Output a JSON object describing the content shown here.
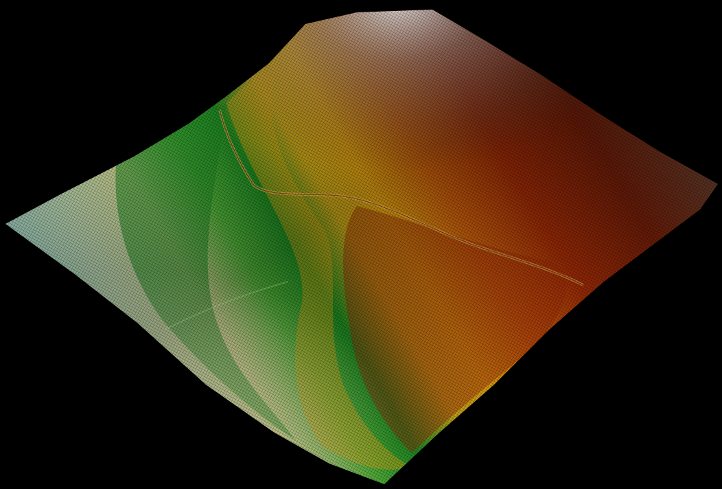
{
  "scene": {
    "background_color": "#000000",
    "subject": "terrain-mesh",
    "colormap": [
      {
        "stop": 0.0,
        "color": "#7fb0ad"
      },
      {
        "stop": 0.18,
        "color": "#b8c98c"
      },
      {
        "stop": 0.32,
        "color": "#2e9a2a"
      },
      {
        "stop": 0.45,
        "color": "#d8a21a"
      },
      {
        "stop": 0.6,
        "color": "#c25a0c"
      },
      {
        "stop": 0.75,
        "color": "#8a1e06"
      },
      {
        "stop": 0.88,
        "color": "#5a2c18"
      },
      {
        "stop": 1.0,
        "color": "#cfcfcf"
      }
    ],
    "wireframe_color": "#000000"
  }
}
